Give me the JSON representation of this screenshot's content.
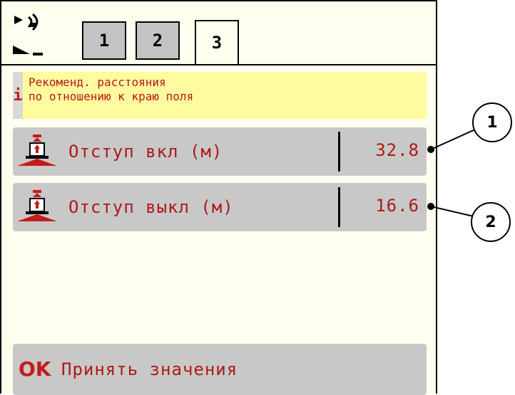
{
  "header": {
    "icons": [
      "gps-signal-icon",
      "spread-side-icon"
    ],
    "tabs": [
      {
        "label": "1",
        "active": false
      },
      {
        "label": "2",
        "active": false
      },
      {
        "label": "3",
        "active": true
      }
    ]
  },
  "info": {
    "icon": "i",
    "text": "Рекоменд. расстояния\nпо отношению к краю поля"
  },
  "params": [
    {
      "label": "Отступ вкл (м)",
      "value": "32.8",
      "icon": "spreader-on-icon"
    },
    {
      "label": "Отступ выкл (м)",
      "value": "16.6",
      "icon": "spreader-off-icon"
    }
  ],
  "ok": {
    "icon_text": "OK",
    "label": "Принять значения"
  },
  "callouts": [
    "1",
    "2"
  ],
  "colors": {
    "accent_text": "#b01818",
    "info_bg": "#fffb9e",
    "row_bg": "#c8c8c8",
    "screen_bg": "#fffff0"
  }
}
